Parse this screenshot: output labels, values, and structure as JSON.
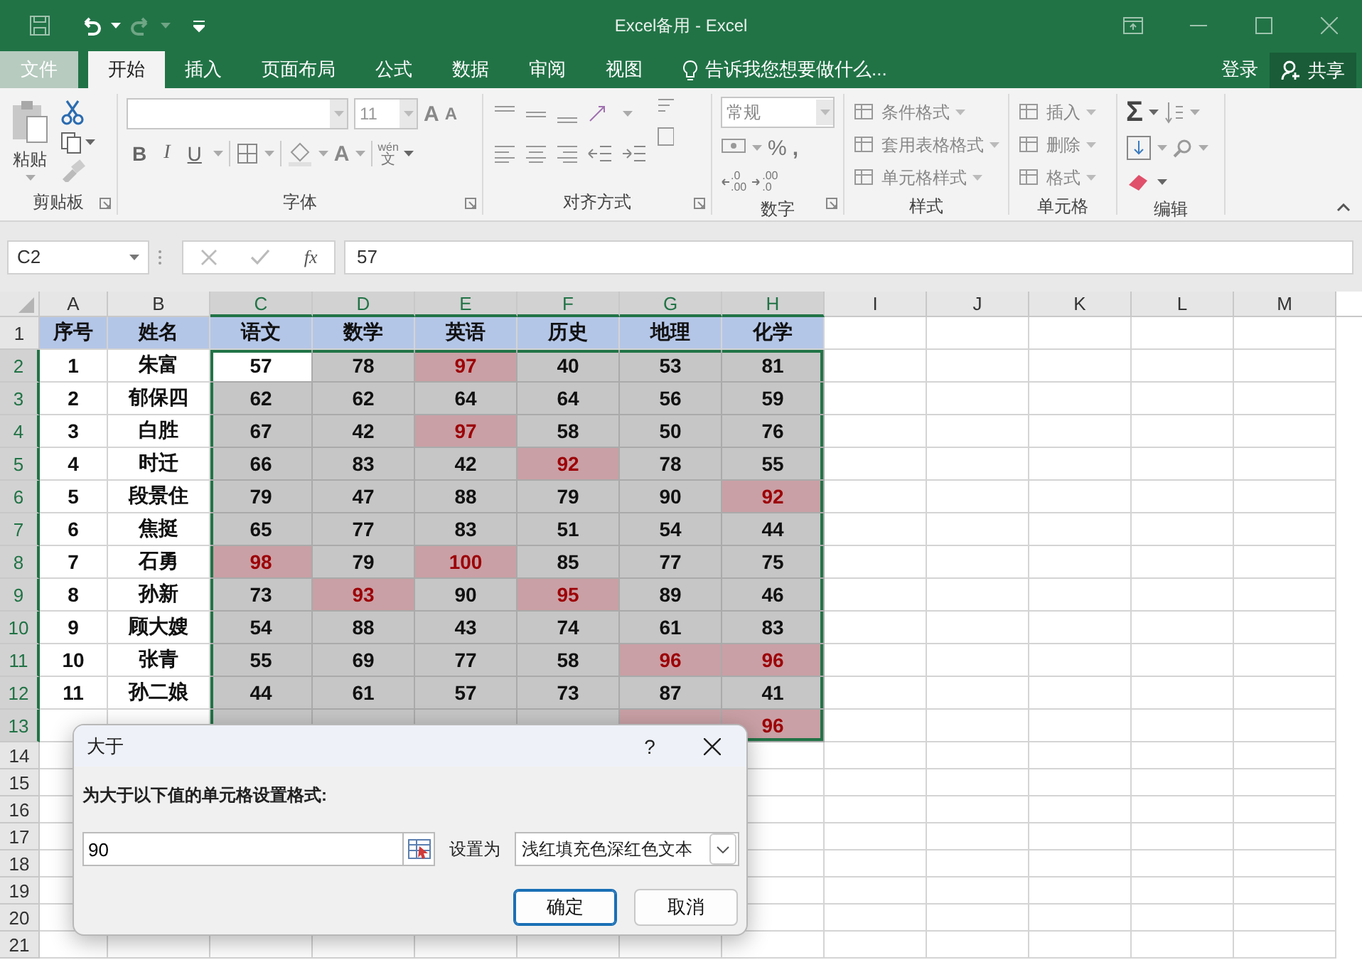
{
  "window": {
    "title": "Excel备用 - Excel"
  },
  "tabs": [
    {
      "label": "文件",
      "kind": "file",
      "selected": false
    },
    {
      "label": "开始",
      "kind": "tab",
      "selected": true
    },
    {
      "label": "插入",
      "kind": "tab",
      "selected": false
    },
    {
      "label": "页面布局",
      "kind": "tab",
      "selected": false
    },
    {
      "label": "公式",
      "kind": "tab",
      "selected": false
    },
    {
      "label": "数据",
      "kind": "tab",
      "selected": false
    },
    {
      "label": "审阅",
      "kind": "tab",
      "selected": false
    },
    {
      "label": "视图",
      "kind": "tab",
      "selected": false
    }
  ],
  "tell_me": "告诉我您想要做什么...",
  "account": {
    "sign_in": "登录",
    "share": "共享"
  },
  "ribbon": {
    "groups": [
      {
        "kind": "clipboard",
        "label": "剪贴板",
        "paste": "粘贴"
      },
      {
        "kind": "font",
        "label": "字体",
        "font_size": "11",
        "style_buttons": [
          "B",
          "I",
          "U"
        ],
        "letter_buttons": [
          "A",
          "A",
          "A"
        ],
        "phonetic": [
          "wén",
          "文"
        ]
      },
      {
        "kind": "alignment",
        "label": "对齐方式"
      },
      {
        "kind": "number",
        "label": "数字",
        "format": "常规",
        "symbols": [
          "%",
          ","
        ],
        "decimals": [
          {
            "top": ".0",
            "bottom": ".00"
          },
          {
            "top": ".00",
            "bottom": ".0"
          }
        ]
      },
      {
        "kind": "list",
        "label": "样式",
        "items": [
          "条件格式",
          "套用表格格式",
          "单元格样式"
        ]
      },
      {
        "kind": "list",
        "label": "单元格",
        "items": [
          "插入",
          "删除",
          "格式"
        ]
      },
      {
        "kind": "editing",
        "label": "编辑",
        "sum": "Σ"
      }
    ]
  },
  "formula_bar": {
    "name_box": "C2",
    "function_label": "fx",
    "value": "57"
  },
  "grid": {
    "columns": [
      {
        "label": "A",
        "selected": false
      },
      {
        "label": "B",
        "selected": false
      },
      {
        "label": "C",
        "selected": true
      },
      {
        "label": "D",
        "selected": true
      },
      {
        "label": "E",
        "selected": true
      },
      {
        "label": "F",
        "selected": true
      },
      {
        "label": "G",
        "selected": true
      },
      {
        "label": "H",
        "selected": true
      },
      {
        "label": "I",
        "selected": false
      },
      {
        "label": "J",
        "selected": false
      },
      {
        "label": "K",
        "selected": false
      },
      {
        "label": "L",
        "selected": false
      },
      {
        "label": "M",
        "selected": false
      }
    ],
    "rows": [
      {
        "label": "1",
        "selected": false,
        "cells": [
          {
            "text": "序号",
            "kind": "header",
            "selected": false,
            "highlighted": false
          },
          {
            "text": "姓名",
            "kind": "header",
            "selected": false,
            "highlighted": false
          },
          {
            "text": "语文",
            "kind": "header",
            "selected": false,
            "highlighted": false
          },
          {
            "text": "数学",
            "kind": "header",
            "selected": false,
            "highlighted": false
          },
          {
            "text": "英语",
            "kind": "header",
            "selected": false,
            "highlighted": false
          },
          {
            "text": "历史",
            "kind": "header",
            "selected": false,
            "highlighted": false
          },
          {
            "text": "地理",
            "kind": "header",
            "selected": false,
            "highlighted": false
          },
          {
            "text": "化学",
            "kind": "header",
            "selected": false,
            "highlighted": false
          }
        ]
      },
      {
        "label": "2",
        "selected": true,
        "cells": [
          {
            "text": "1",
            "kind": "data",
            "selected": false,
            "highlighted": false
          },
          {
            "text": "朱富",
            "kind": "data",
            "selected": false,
            "highlighted": false
          },
          {
            "text": "57",
            "kind": "active",
            "selected": true,
            "highlighted": false
          },
          {
            "text": "78",
            "kind": "data",
            "selected": true,
            "highlighted": false
          },
          {
            "text": "97",
            "kind": "data",
            "selected": true,
            "highlighted": true
          },
          {
            "text": "40",
            "kind": "data",
            "selected": true,
            "highlighted": false
          },
          {
            "text": "53",
            "kind": "data",
            "selected": true,
            "highlighted": false
          },
          {
            "text": "81",
            "kind": "data",
            "selected": true,
            "highlighted": false
          }
        ]
      },
      {
        "label": "3",
        "selected": true,
        "cells": [
          {
            "text": "2",
            "kind": "data",
            "selected": false,
            "highlighted": false
          },
          {
            "text": "郁保四",
            "kind": "data",
            "selected": false,
            "highlighted": false
          },
          {
            "text": "62",
            "kind": "data",
            "selected": true,
            "highlighted": false
          },
          {
            "text": "62",
            "kind": "data",
            "selected": true,
            "highlighted": false
          },
          {
            "text": "64",
            "kind": "data",
            "selected": true,
            "highlighted": false
          },
          {
            "text": "64",
            "kind": "data",
            "selected": true,
            "highlighted": false
          },
          {
            "text": "56",
            "kind": "data",
            "selected": true,
            "highlighted": false
          },
          {
            "text": "59",
            "kind": "data",
            "selected": true,
            "highlighted": false
          }
        ]
      },
      {
        "label": "4",
        "selected": true,
        "cells": [
          {
            "text": "3",
            "kind": "data",
            "selected": false,
            "highlighted": false
          },
          {
            "text": "白胜",
            "kind": "data",
            "selected": false,
            "highlighted": false
          },
          {
            "text": "67",
            "kind": "data",
            "selected": true,
            "highlighted": false
          },
          {
            "text": "42",
            "kind": "data",
            "selected": true,
            "highlighted": false
          },
          {
            "text": "97",
            "kind": "data",
            "selected": true,
            "highlighted": true
          },
          {
            "text": "58",
            "kind": "data",
            "selected": true,
            "highlighted": false
          },
          {
            "text": "50",
            "kind": "data",
            "selected": true,
            "highlighted": false
          },
          {
            "text": "76",
            "kind": "data",
            "selected": true,
            "highlighted": false
          }
        ]
      },
      {
        "label": "5",
        "selected": true,
        "cells": [
          {
            "text": "4",
            "kind": "data",
            "selected": false,
            "highlighted": false
          },
          {
            "text": "时迁",
            "kind": "data",
            "selected": false,
            "highlighted": false
          },
          {
            "text": "66",
            "kind": "data",
            "selected": true,
            "highlighted": false
          },
          {
            "text": "83",
            "kind": "data",
            "selected": true,
            "highlighted": false
          },
          {
            "text": "42",
            "kind": "data",
            "selected": true,
            "highlighted": false
          },
          {
            "text": "92",
            "kind": "data",
            "selected": true,
            "highlighted": true
          },
          {
            "text": "78",
            "kind": "data",
            "selected": true,
            "highlighted": false
          },
          {
            "text": "55",
            "kind": "data",
            "selected": true,
            "highlighted": false
          }
        ]
      },
      {
        "label": "6",
        "selected": true,
        "cells": [
          {
            "text": "5",
            "kind": "data",
            "selected": false,
            "highlighted": false
          },
          {
            "text": "段景住",
            "kind": "data",
            "selected": false,
            "highlighted": false
          },
          {
            "text": "79",
            "kind": "data",
            "selected": true,
            "highlighted": false
          },
          {
            "text": "47",
            "kind": "data",
            "selected": true,
            "highlighted": false
          },
          {
            "text": "88",
            "kind": "data",
            "selected": true,
            "highlighted": false
          },
          {
            "text": "79",
            "kind": "data",
            "selected": true,
            "highlighted": false
          },
          {
            "text": "90",
            "kind": "data",
            "selected": true,
            "highlighted": false
          },
          {
            "text": "92",
            "kind": "data",
            "selected": true,
            "highlighted": true
          }
        ]
      },
      {
        "label": "7",
        "selected": true,
        "cells": [
          {
            "text": "6",
            "kind": "data",
            "selected": false,
            "highlighted": false
          },
          {
            "text": "焦挺",
            "kind": "data",
            "selected": false,
            "highlighted": false
          },
          {
            "text": "65",
            "kind": "data",
            "selected": true,
            "highlighted": false
          },
          {
            "text": "77",
            "kind": "data",
            "selected": true,
            "highlighted": false
          },
          {
            "text": "83",
            "kind": "data",
            "selected": true,
            "highlighted": false
          },
          {
            "text": "51",
            "kind": "data",
            "selected": true,
            "highlighted": false
          },
          {
            "text": "54",
            "kind": "data",
            "selected": true,
            "highlighted": false
          },
          {
            "text": "44",
            "kind": "data",
            "selected": true,
            "highlighted": false
          }
        ]
      },
      {
        "label": "8",
        "selected": true,
        "cells": [
          {
            "text": "7",
            "kind": "data",
            "selected": false,
            "highlighted": false
          },
          {
            "text": "石勇",
            "kind": "data",
            "selected": false,
            "highlighted": false
          },
          {
            "text": "98",
            "kind": "data",
            "selected": true,
            "highlighted": true
          },
          {
            "text": "79",
            "kind": "data",
            "selected": true,
            "highlighted": false
          },
          {
            "text": "100",
            "kind": "data",
            "selected": true,
            "highlighted": true
          },
          {
            "text": "85",
            "kind": "data",
            "selected": true,
            "highlighted": false
          },
          {
            "text": "77",
            "kind": "data",
            "selected": true,
            "highlighted": false
          },
          {
            "text": "75",
            "kind": "data",
            "selected": true,
            "highlighted": false
          }
        ]
      },
      {
        "label": "9",
        "selected": true,
        "cells": [
          {
            "text": "8",
            "kind": "data",
            "selected": false,
            "highlighted": false
          },
          {
            "text": "孙新",
            "kind": "data",
            "selected": false,
            "highlighted": false
          },
          {
            "text": "73",
            "kind": "data",
            "selected": true,
            "highlighted": false
          },
          {
            "text": "93",
            "kind": "data",
            "selected": true,
            "highlighted": true
          },
          {
            "text": "90",
            "kind": "data",
            "selected": true,
            "highlighted": false
          },
          {
            "text": "95",
            "kind": "data",
            "selected": true,
            "highlighted": true
          },
          {
            "text": "89",
            "kind": "data",
            "selected": true,
            "highlighted": false
          },
          {
            "text": "46",
            "kind": "data",
            "selected": true,
            "highlighted": false
          }
        ]
      },
      {
        "label": "10",
        "selected": true,
        "cells": [
          {
            "text": "9",
            "kind": "data",
            "selected": false,
            "highlighted": false
          },
          {
            "text": "顾大嫂",
            "kind": "data",
            "selected": false,
            "highlighted": false
          },
          {
            "text": "54",
            "kind": "data",
            "selected": true,
            "highlighted": false
          },
          {
            "text": "88",
            "kind": "data",
            "selected": true,
            "highlighted": false
          },
          {
            "text": "43",
            "kind": "data",
            "selected": true,
            "highlighted": false
          },
          {
            "text": "74",
            "kind": "data",
            "selected": true,
            "highlighted": false
          },
          {
            "text": "61",
            "kind": "data",
            "selected": true,
            "highlighted": false
          },
          {
            "text": "83",
            "kind": "data",
            "selected": true,
            "highlighted": false
          }
        ]
      },
      {
        "label": "11",
        "selected": true,
        "cells": [
          {
            "text": "10",
            "kind": "data",
            "selected": false,
            "highlighted": false
          },
          {
            "text": "张青",
            "kind": "data",
            "selected": false,
            "highlighted": false
          },
          {
            "text": "55",
            "kind": "data",
            "selected": true,
            "highlighted": false
          },
          {
            "text": "69",
            "kind": "data",
            "selected": true,
            "highlighted": false
          },
          {
            "text": "77",
            "kind": "data",
            "selected": true,
            "highlighted": false
          },
          {
            "text": "58",
            "kind": "data",
            "selected": true,
            "highlighted": false
          },
          {
            "text": "96",
            "kind": "data",
            "selected": true,
            "highlighted": true
          },
          {
            "text": "96",
            "kind": "data",
            "selected": true,
            "highlighted": true
          }
        ]
      },
      {
        "label": "12",
        "selected": true,
        "cells": [
          {
            "text": "11",
            "kind": "data",
            "selected": false,
            "highlighted": false
          },
          {
            "text": "孙二娘",
            "kind": "data",
            "selected": false,
            "highlighted": false
          },
          {
            "text": "44",
            "kind": "data",
            "selected": true,
            "highlighted": false
          },
          {
            "text": "61",
            "kind": "data",
            "selected": true,
            "highlighted": false
          },
          {
            "text": "57",
            "kind": "data",
            "selected": true,
            "highlighted": false
          },
          {
            "text": "73",
            "kind": "data",
            "selected": true,
            "highlighted": false
          },
          {
            "text": "87",
            "kind": "data",
            "selected": true,
            "highlighted": false
          },
          {
            "text": "41",
            "kind": "data",
            "selected": true,
            "highlighted": false
          }
        ]
      },
      {
        "label": "13",
        "selected": true,
        "cells": [
          {
            "kind": "data",
            "selected": false,
            "highlighted": false
          },
          {
            "kind": "data",
            "selected": false,
            "highlighted": false
          },
          {
            "kind": "data",
            "selected": true,
            "highlighted": false
          },
          {
            "kind": "data",
            "selected": true,
            "highlighted": false
          },
          {
            "kind": "data",
            "selected": true,
            "highlighted": false
          },
          {
            "kind": "data",
            "selected": true,
            "highlighted": false
          },
          {
            "kind": "data",
            "selected": true,
            "highlighted": true
          },
          {
            "text": "96",
            "kind": "data",
            "selected": true,
            "highlighted": true
          }
        ]
      },
      {
        "label": "14",
        "selected": false
      },
      {
        "label": "15",
        "selected": false
      },
      {
        "label": "16",
        "selected": false
      },
      {
        "label": "17",
        "selected": false
      },
      {
        "label": "18",
        "selected": false
      },
      {
        "label": "19",
        "selected": false
      },
      {
        "label": "20",
        "selected": false
      },
      {
        "label": "21",
        "selected": false
      }
    ]
  },
  "dialog": {
    "title": "大于",
    "help": "?",
    "prompt": "为大于以下值的单元格设置格式:",
    "value": "90",
    "format_label": "设置为",
    "format": "浅红填充色深红色文本",
    "buttons": [
      {
        "label": "确定",
        "kind": "default"
      },
      {
        "label": "取消",
        "kind": "normal"
      }
    ]
  }
}
